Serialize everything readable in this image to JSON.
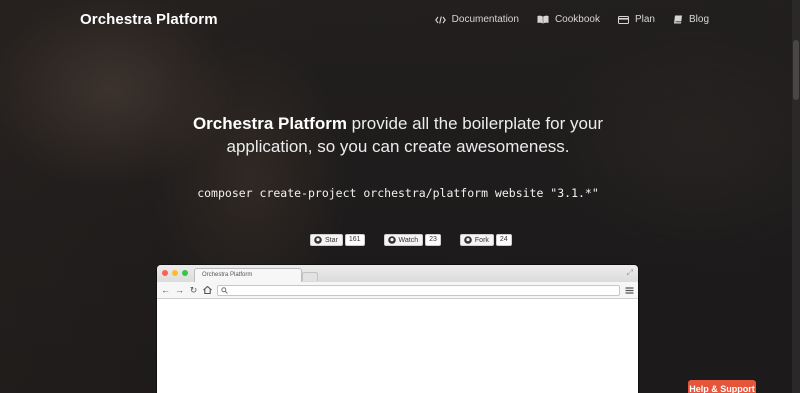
{
  "brand": "Orchestra Platform",
  "nav": {
    "items": [
      {
        "label": "Documentation",
        "icon": "code-icon"
      },
      {
        "label": "Cookbook",
        "icon": "book-open-icon"
      },
      {
        "label": "Plan",
        "icon": "credit-card-icon"
      },
      {
        "label": "Blog",
        "icon": "book-icon"
      }
    ]
  },
  "hero": {
    "headline_bold": "Orchestra Platform",
    "headline_line1_rest": " provide all the boilerplate for your",
    "headline_line2": "application, so you can create awesomeness.",
    "command": "composer create-project orchestra/platform website \"3.1.*\""
  },
  "github": {
    "star": {
      "label": "Star",
      "count": "161"
    },
    "watch": {
      "label": "Watch",
      "count": "23"
    },
    "fork": {
      "label": "Fork",
      "count": "24"
    }
  },
  "browser": {
    "tab_title": "Orchestra Platform",
    "expand_icon": "⤢",
    "dots": [
      "#fc5f57",
      "#fdbc2e",
      "#33c748"
    ]
  },
  "help": {
    "label": "Help & Support",
    "color": "#e4553b"
  }
}
